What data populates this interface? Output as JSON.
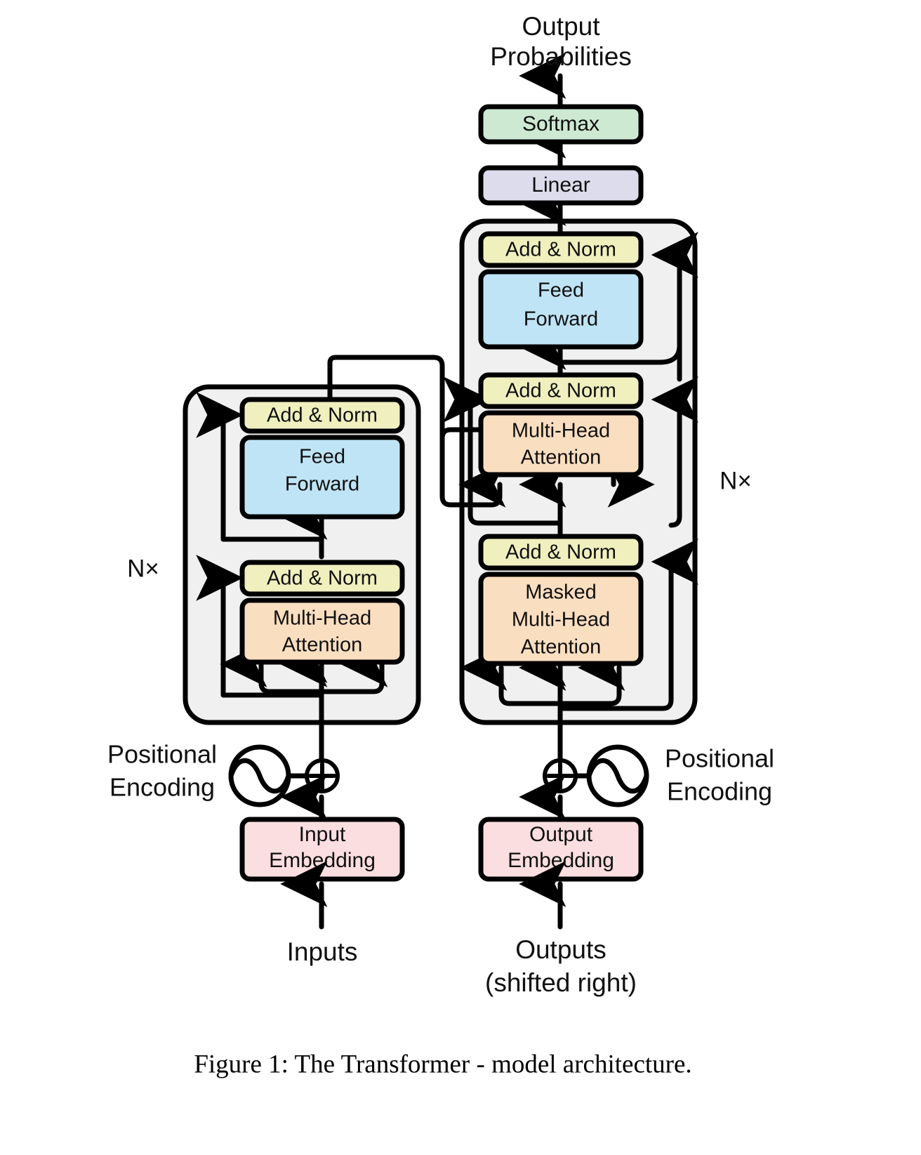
{
  "figure": {
    "caption": "Figure 1: The Transformer - model architecture.",
    "top_label_line1": "Output",
    "top_label_line2": "Probabilities"
  },
  "colors": {
    "softmax": "#cde9d2",
    "linear": "#dcdcec",
    "add_norm": "#f0f0bf",
    "feed_forward": "#bfe4f5",
    "attention": "#fadec0",
    "embedding": "#fadee0",
    "panel": "#f0f0f0",
    "stroke": "#000000",
    "background": "#ffffff"
  },
  "head": {
    "softmax": "Softmax",
    "linear": "Linear"
  },
  "encoder": {
    "stack_label": "N×",
    "add_norm_top": "Add & Norm",
    "feed_forward_line1": "Feed",
    "feed_forward_line2": "Forward",
    "add_norm_bottom": "Add & Norm",
    "attention_line1": "Multi-Head",
    "attention_line2": "Attention",
    "positional_line1": "Positional",
    "positional_line2": "Encoding",
    "embedding_line1": "Input",
    "embedding_line2": "Embedding",
    "source_label": "Inputs",
    "plus_symbol": "⊕"
  },
  "decoder": {
    "stack_label": "N×",
    "add_norm_top": "Add & Norm",
    "feed_forward_line1": "Feed",
    "feed_forward_line2": "Forward",
    "add_norm_mid": "Add & Norm",
    "cross_attention_line1": "Multi-Head",
    "cross_attention_line2": "Attention",
    "add_norm_bottom": "Add & Norm",
    "masked_attention_line1": "Masked",
    "masked_attention_line2": "Multi-Head",
    "masked_attention_line3": "Attention",
    "positional_line1": "Positional",
    "positional_line2": "Encoding",
    "embedding_line1": "Output",
    "embedding_line2": "Embedding",
    "source_line1": "Outputs",
    "source_line2": "(shifted right)",
    "plus_symbol": "⊕"
  }
}
